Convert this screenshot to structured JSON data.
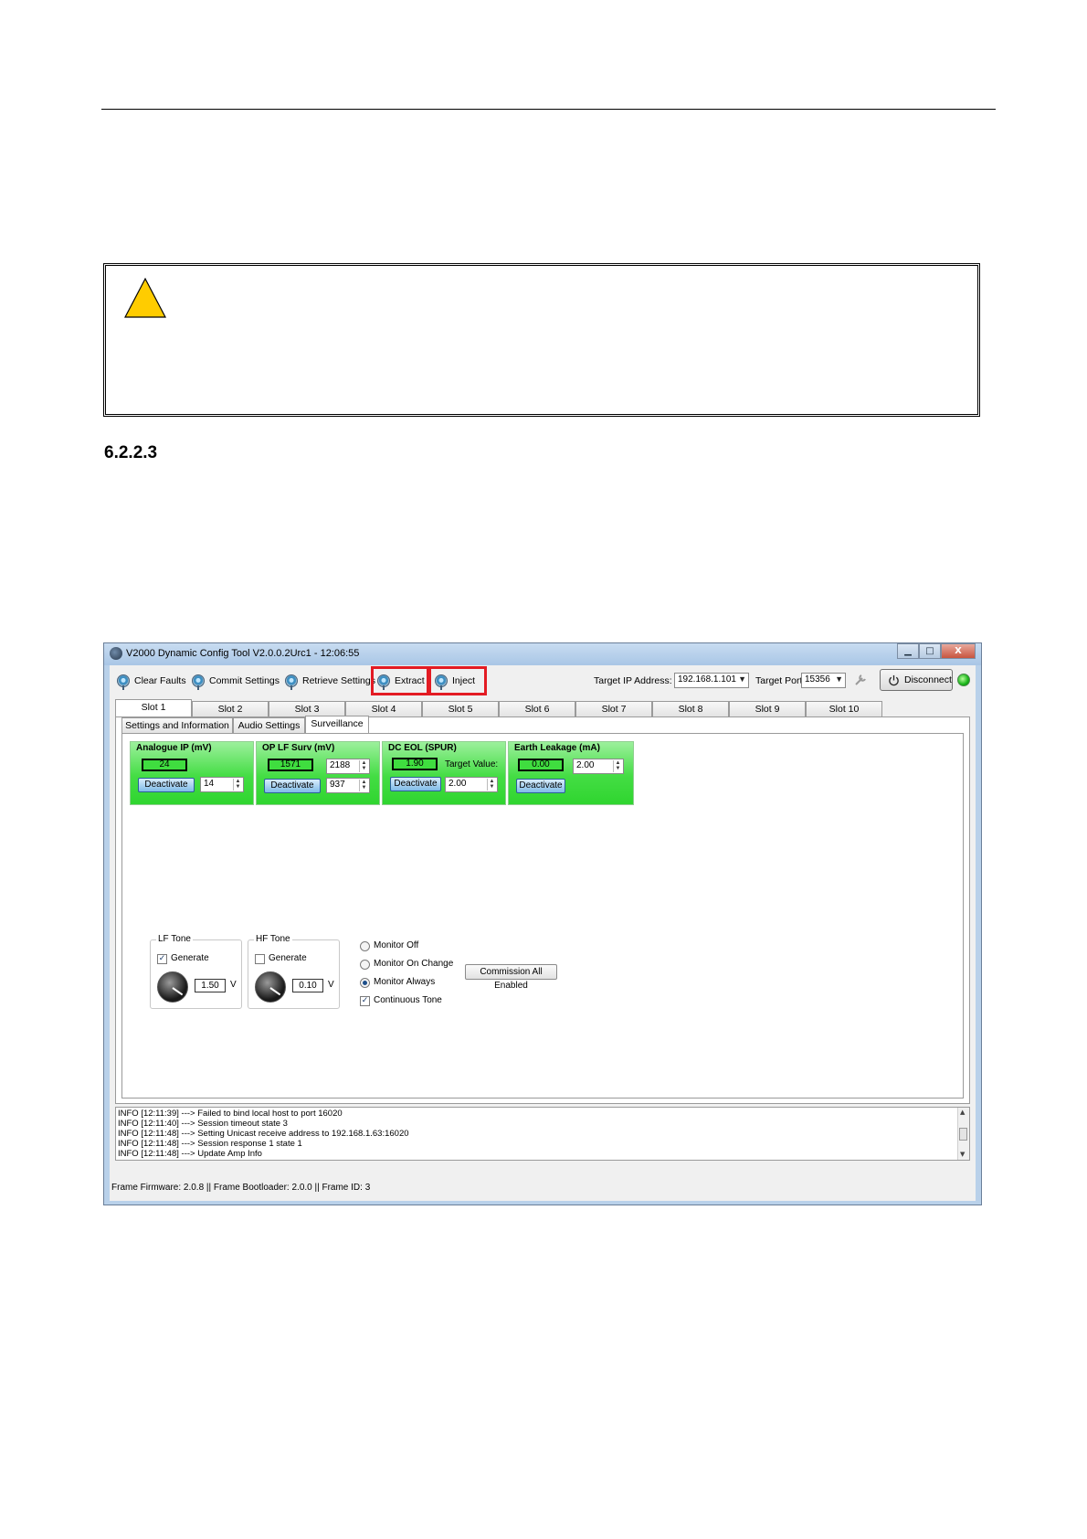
{
  "document": {
    "section_number": "6.2.2.3"
  },
  "window": {
    "title": "V2000 Dynamic Config Tool V2.0.0.2Urc1 - 12:06:55",
    "controls": {
      "minimize": "▁",
      "maximize": "□",
      "close": "X"
    }
  },
  "toolbar": {
    "clear_faults": "Clear Faults",
    "commit_settings": "Commit Settings",
    "retrieve_settings": "Retrieve Settings",
    "extract": "Extract",
    "inject": "Inject",
    "target_ip_label": "Target IP Address:",
    "target_ip_value": "192.168.1.101",
    "target_port_label": "Target Port:",
    "target_port_value": "15356",
    "disconnect": "Disconnect",
    "highlight_color": "#e31b23",
    "status_color": "#18b418"
  },
  "slot_tabs": [
    "Slot 1",
    "Slot 2",
    "Slot 3",
    "Slot 4",
    "Slot 5",
    "Slot 6",
    "Slot 7",
    "Slot 8",
    "Slot 9",
    "Slot 10"
  ],
  "sub_tabs": [
    "Settings and Information",
    "Audio Settings",
    "Surveillance"
  ],
  "surveillance": {
    "analogue_ip": {
      "title": "Analogue IP (mV)",
      "value": "24",
      "button": "Deactivate",
      "threshold": "14"
    },
    "op_lf_surv": {
      "title": "OP LF Surv (mV)",
      "value": "1571",
      "upper": "2188",
      "button": "Deactivate",
      "lower": "937"
    },
    "dc_eol": {
      "title": "DC EOL (SPUR)",
      "value": "1.90",
      "target_label": "Target Value:",
      "button": "Deactivate",
      "target_value": "2.00"
    },
    "earth_leakage": {
      "title": "Earth Leakage (mA)",
      "value": "0.00",
      "threshold": "2.00",
      "button": "Deactivate"
    }
  },
  "tones": {
    "lf": {
      "title": "LF Tone",
      "generate_label": "Generate",
      "generate_checked": true,
      "level": "1.50",
      "unit": "V"
    },
    "hf": {
      "title": "HF Tone",
      "generate_label": "Generate",
      "generate_checked": false,
      "level": "0.10",
      "unit": "V"
    }
  },
  "monitor": {
    "options": [
      "Monitor Off",
      "Monitor On Change",
      "Monitor Always"
    ],
    "selected": "Monitor Always",
    "continuous_tone": "Continuous Tone",
    "continuous_checked": true,
    "commission_button": "Commission All Enabled"
  },
  "log": [
    "INFO [12:11:39] ---> Failed to bind local host to port 16020",
    "INFO [12:11:40] ---> Session timeout state 3",
    "INFO [12:11:48] ---> Setting Unicast receive address to 192.168.1.63:16020",
    "INFO [12:11:48] ---> Session response 1 state 1",
    "INFO [12:11:48] ---> Update Amp Info"
  ],
  "status_bar": "Frame Firmware: 2.0.8 || Frame Bootloader: 2.0.0 || Frame ID: 3"
}
